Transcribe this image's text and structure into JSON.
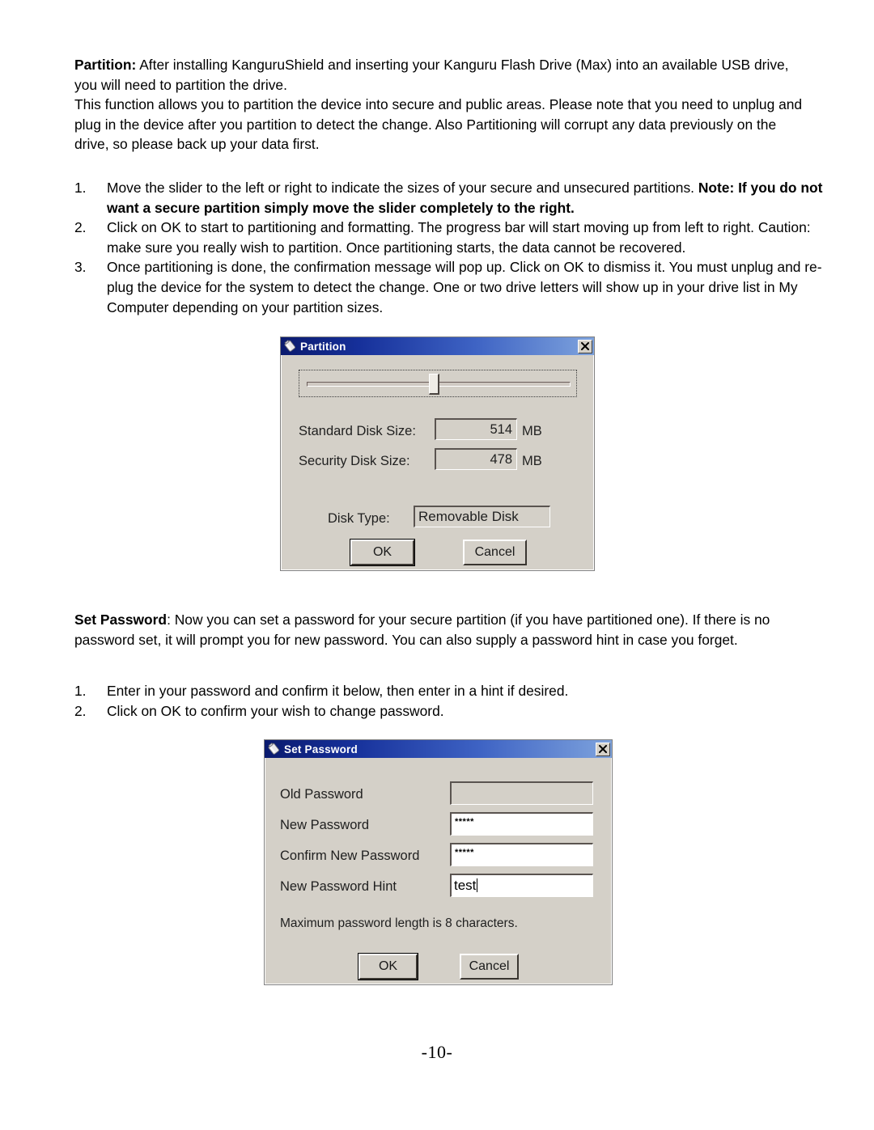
{
  "document": {
    "paragraphs": {
      "partition_lead": "Partition:",
      "partition_intro": " After installing KanguruShield and inserting your Kanguru Flash Drive (Max) into an available USB drive, you will need to partition the drive.",
      "partition_intro2": "This function allows you to partition the device into secure and public areas. Please note that you need to unplug and plug in the device after you partition to detect the change. Also Partitioning will corrupt any data previously on the drive, so please back up your data first.",
      "setpassword_lead": "Set Password",
      "setpassword_intro": ": Now you can set a password for your secure partition (if you have partitioned one). If there is no password set, it will prompt you for new password. You can also supply a password hint in case you forget."
    },
    "partition_steps": [
      {
        "num": "1.",
        "text_normal": "Move the slider to the left or right to indicate the sizes of your secure and unsecured partitions. ",
        "text_bold": "Note: If you do not want a secure partition simply move the slider completely to the right."
      },
      {
        "num": "2.",
        "text_normal": "Click on OK to start to partitioning and formatting. The progress bar will start moving up from left to right. Caution: make sure you really wish to partition. Once partitioning starts, the data cannot be recovered.",
        "text_bold": ""
      },
      {
        "num": "3.",
        "text_normal": "Once partitioning is done, the confirmation message will pop up. Click on OK to dismiss it. You must unplug and re-plug the device for the system to detect the change. One or two drive letters will show up in your drive list in My Computer depending on your partition sizes.",
        "text_bold": ""
      }
    ],
    "setpassword_steps": [
      {
        "num": "1.",
        "text_normal": "Enter in your password and confirm it below, then enter in a hint if desired.",
        "text_bold": ""
      },
      {
        "num": "2.",
        "text_normal": "Click on OK to confirm your wish to change password.",
        "text_bold": ""
      }
    ],
    "page_number": "-10-"
  },
  "partition_dialog": {
    "title": "Partition",
    "icon": "usb-flash-drive-icon",
    "close_label": "✕",
    "slider": {
      "value_percent": 50,
      "name": "partition-size-slider"
    },
    "fields": [
      {
        "label": "Standard Disk Size:",
        "value": "514",
        "unit": "MB"
      },
      {
        "label": "Security Disk Size:",
        "value": "478",
        "unit": "MB"
      }
    ],
    "disk_type_label": "Disk Type:",
    "disk_type_value": "Removable Disk",
    "ok_label": "OK",
    "cancel_label": "Cancel"
  },
  "setpassword_dialog": {
    "title": "Set Password",
    "icon": "usb-flash-drive-icon",
    "close_label": "✕",
    "rows": [
      {
        "label": "Old Password",
        "value": "",
        "disabled": true
      },
      {
        "label": "New Password",
        "value": "*****",
        "disabled": false
      },
      {
        "label": "Confirm New Password",
        "value": "*****",
        "disabled": false
      },
      {
        "label": "New Password Hint",
        "value": "test",
        "disabled": false
      }
    ],
    "note": "Maximum password length is 8 characters.",
    "ok_label": "OK",
    "cancel_label": "Cancel"
  },
  "colors": {
    "dialog_face": "#d4d0c8",
    "titlebar_start": "#0a1a6e",
    "titlebar_end": "#7ea3dd",
    "page_background": "#ffffff",
    "text": "#000000"
  }
}
